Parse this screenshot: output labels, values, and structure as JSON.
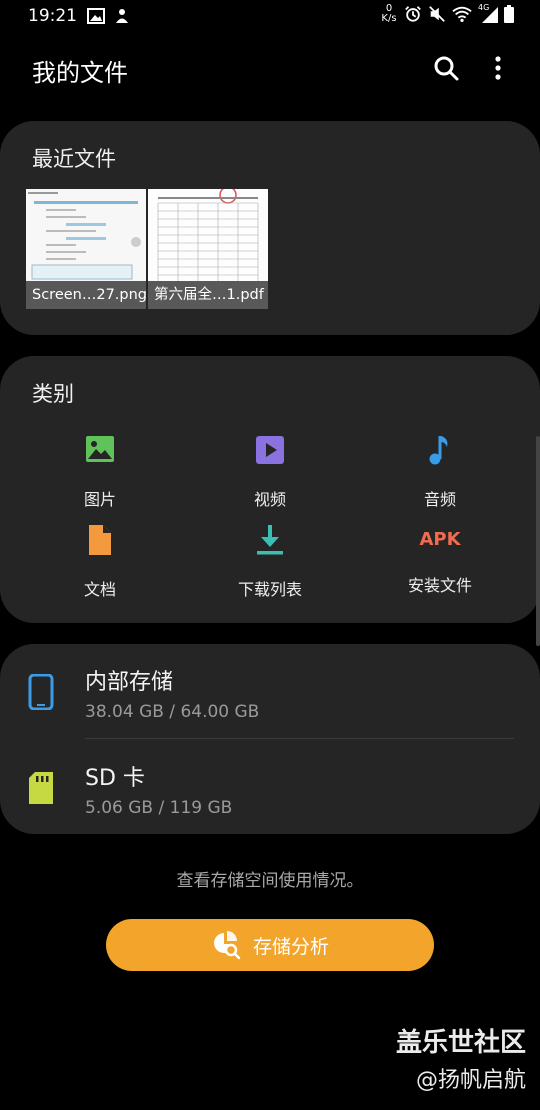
{
  "status": {
    "time": "19:21",
    "net_speed_value": "0",
    "net_speed_unit": "K/s",
    "network": "4G"
  },
  "appbar": {
    "title": "我的文件"
  },
  "recent": {
    "title": "最近文件",
    "files": [
      {
        "name": "Screen…27.png"
      },
      {
        "name": "第六届全…1.pdf"
      }
    ]
  },
  "categories": {
    "title": "类别",
    "items": [
      {
        "label": "图片",
        "icon": "image-icon",
        "color": "#5fc35a"
      },
      {
        "label": "视频",
        "icon": "video-icon",
        "color": "#8a73e0"
      },
      {
        "label": "音频",
        "icon": "audio-icon",
        "color": "#3a9ce8"
      },
      {
        "label": "文档",
        "icon": "document-icon",
        "color": "#f29a3d"
      },
      {
        "label": "下载列表",
        "icon": "download-icon",
        "color": "#3bbfb4"
      },
      {
        "label": "安装文件",
        "icon": "apk-icon",
        "icon_text": "APK",
        "color": "#f06b4f"
      }
    ]
  },
  "storage": {
    "internal": {
      "name": "内部存储",
      "size": "38.04 GB / 64.00 GB",
      "color": "#3a9ce8"
    },
    "sd": {
      "name": "SD 卡",
      "size": "5.06 GB / 119 GB",
      "color": "#c6d842"
    }
  },
  "footer": {
    "hint": "查看存储空间使用情况。",
    "analyze_label": "存储分析"
  },
  "watermark": {
    "line1": "盖乐世社区",
    "line2": "@扬帆启航"
  },
  "colors": {
    "accent": "#f2a52a",
    "card": "#252525",
    "background": "#000000"
  }
}
